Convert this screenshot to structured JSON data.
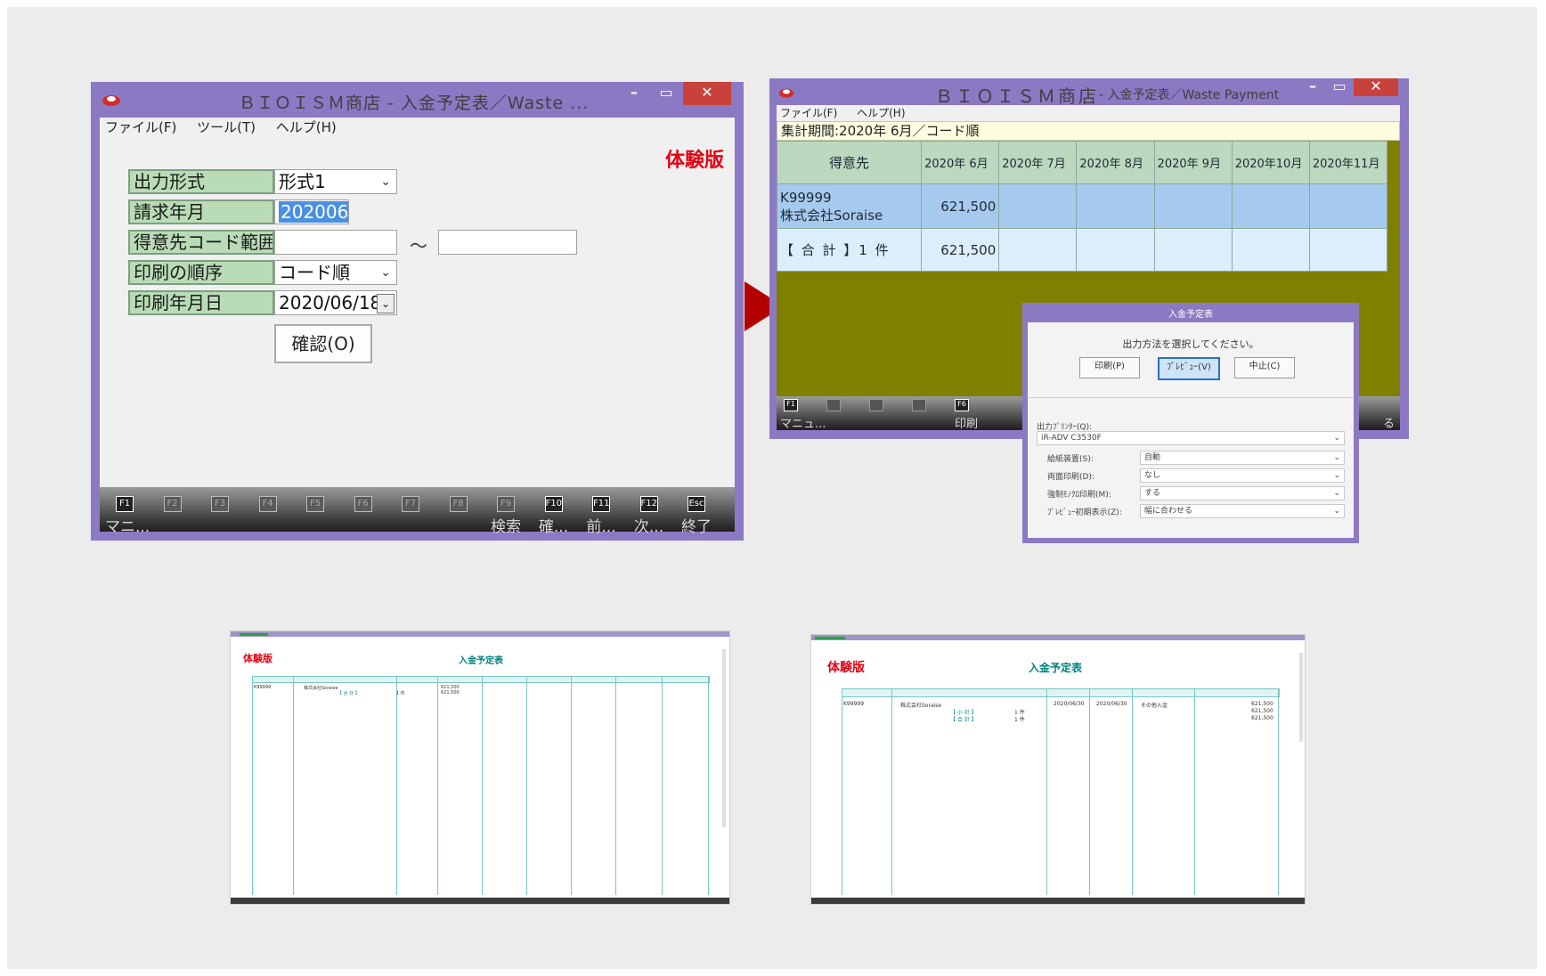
{
  "win1": {
    "title": "ＢＩＯＩＳＭ商店 - 入金予定表／Waste ...",
    "menus": [
      "ファイル(F)",
      "ツール(T)",
      "ヘルプ(H)"
    ],
    "trial_badge": "体験版",
    "form": {
      "output_format_label": "出力形式",
      "output_format_value": "形式1",
      "billing_month_label": "請求年月",
      "billing_month_value": "202006",
      "customer_range_label": "得意先コード範囲",
      "range_separator": "～",
      "print_order_label": "印刷の順序",
      "print_order_value": "コード順",
      "print_date_label": "印刷年月日",
      "print_date_value": "2020/06/18",
      "confirm_button": "確認(O)"
    },
    "fkeys": [
      {
        "key": "F1",
        "caption": "マニ...",
        "enabled": true
      },
      {
        "key": "F2",
        "caption": "",
        "enabled": false
      },
      {
        "key": "F3",
        "caption": "",
        "enabled": false
      },
      {
        "key": "F4",
        "caption": "",
        "enabled": false
      },
      {
        "key": "F5",
        "caption": "",
        "enabled": false
      },
      {
        "key": "F6",
        "caption": "",
        "enabled": false
      },
      {
        "key": "F7",
        "caption": "",
        "enabled": false
      },
      {
        "key": "F8",
        "caption": "",
        "enabled": false
      },
      {
        "key": "F9",
        "caption": "検索",
        "enabled": false
      },
      {
        "key": "F10",
        "caption": "確...",
        "enabled": true
      },
      {
        "key": "F11",
        "caption": "前...",
        "enabled": true
      },
      {
        "key": "F12",
        "caption": "次...",
        "enabled": true
      },
      {
        "key": "Esc",
        "caption": "終了",
        "enabled": true
      }
    ]
  },
  "win2": {
    "title": "ＢＩＯＩＳＭ商店",
    "title_suffix": "- 入金予定表／Waste Payment",
    "menus": [
      "ファイル(F)",
      "ヘルプ(H)"
    ],
    "period_text": "集計期間:2020年 6月／コード順",
    "grid": {
      "headers": [
        "得意先",
        "2020年 6月",
        "2020年 7月",
        "2020年 8月",
        "2020年 9月",
        "2020年10月",
        "2020年11月"
      ],
      "row1_code": "K99999",
      "row1_name": "株式会社Soraise",
      "row1_amount": "621,500",
      "total_label": "【 合 計 】1 件",
      "total_amount": "621,500"
    },
    "fkey_captions": [
      "マニュ...",
      "印刷",
      "る"
    ],
    "fkey_keys": [
      "F1",
      "F6"
    ],
    "dialog": {
      "title": "入金予定表",
      "prompt": "出力方法を選択してください。",
      "buttons": [
        "印刷(P)",
        "ﾌﾟﾚﾋﾞｭｰ(V)",
        "中止(C)"
      ],
      "printer_label": "出力ﾌﾟﾘﾝﾀｰ(Q):",
      "printer_value": "iR-ADV C3530F",
      "options": [
        {
          "label": "給紙装置(S):",
          "value": "自動"
        },
        {
          "label": "両面印刷(D):",
          "value": "なし"
        },
        {
          "label": "強制ﾓﾉｸﾛ印刷(M):",
          "value": "する"
        },
        {
          "label": "ﾌﾟﾚﾋﾞｭｰ初期表示(Z):",
          "value": "幅に合わせる"
        }
      ]
    }
  },
  "preview1": {
    "trial": "体験版",
    "title": "入金予定表",
    "code": "K99999",
    "name": "株式会社Soraise",
    "total": "【 合 計 】",
    "count": "1 件",
    "amount": "621,500"
  },
  "preview2": {
    "trial": "体験版",
    "title": "入金予定表",
    "code": "K99999",
    "name": "株式会社Soraise",
    "date1": "2020/06/30",
    "date2": "2020/06/30",
    "method": "その他入金",
    "subtotal": "【 小 計 】",
    "total": "【 合 計 】",
    "count": "1 件",
    "amount": "621,500"
  },
  "colors": {
    "window_frame": "#8c79c4",
    "close_button": "#c8413b",
    "label_bg": "#b9dcb6",
    "trial_red": "#e60012",
    "grid_selected": "#a6c9ee",
    "grid_rows": "#dceefb",
    "olive_bg": "#7f7f00",
    "arrow": "#b30000"
  }
}
